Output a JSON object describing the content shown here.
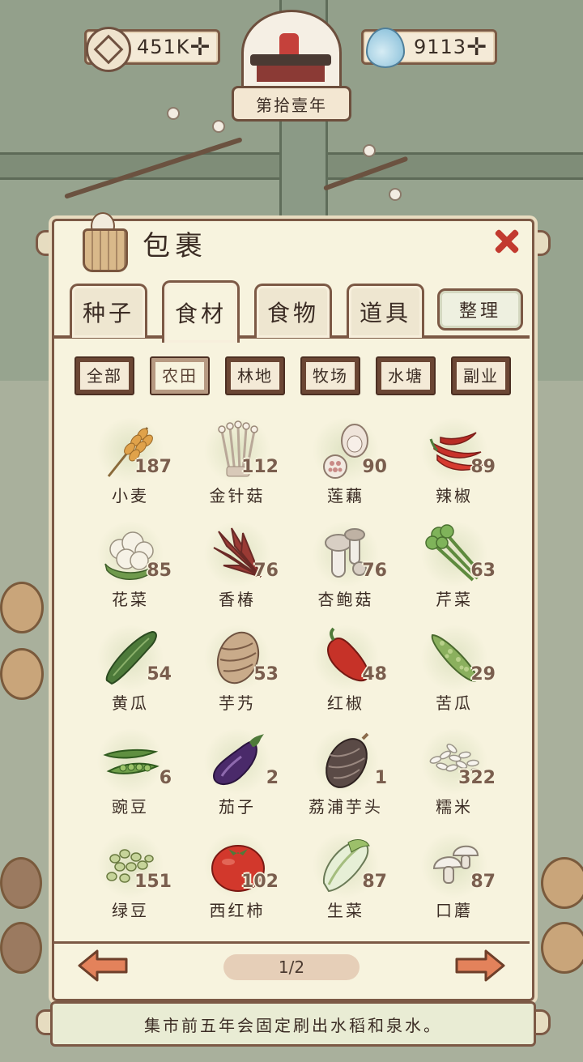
{
  "header": {
    "coins": "451K",
    "water": "9113",
    "year": "第拾壹年"
  },
  "panel": {
    "title": "包裹",
    "tabs": [
      {
        "label": "种子",
        "active": false
      },
      {
        "label": "食材",
        "active": true
      },
      {
        "label": "食物",
        "active": false
      },
      {
        "label": "道具",
        "active": false
      }
    ],
    "sort_label": "整理",
    "filters": [
      {
        "label": "全部",
        "active": false
      },
      {
        "label": "农田",
        "active": true
      },
      {
        "label": "林地",
        "active": false
      },
      {
        "label": "牧场",
        "active": false
      },
      {
        "label": "水塘",
        "active": false
      },
      {
        "label": "副业",
        "active": false
      }
    ],
    "items": [
      {
        "name": "小麦",
        "count": "187",
        "icon": "wheat-icon"
      },
      {
        "name": "金针菇",
        "count": "112",
        "icon": "enoki-icon"
      },
      {
        "name": "莲藕",
        "count": "90",
        "icon": "lotus-root-icon"
      },
      {
        "name": "辣椒",
        "count": "89",
        "icon": "chili-icon"
      },
      {
        "name": "花菜",
        "count": "85",
        "icon": "cauliflower-icon"
      },
      {
        "name": "香椿",
        "count": "76",
        "icon": "toon-sprout-icon"
      },
      {
        "name": "杏鲍菇",
        "count": "76",
        "icon": "king-oyster-icon"
      },
      {
        "name": "芹菜",
        "count": "63",
        "icon": "celery-icon"
      },
      {
        "name": "黄瓜",
        "count": "54",
        "icon": "cucumber-icon"
      },
      {
        "name": "芋艿",
        "count": "53",
        "icon": "taro-icon"
      },
      {
        "name": "红椒",
        "count": "48",
        "icon": "red-pepper-icon"
      },
      {
        "name": "苦瓜",
        "count": "29",
        "icon": "bitter-melon-icon"
      },
      {
        "name": "豌豆",
        "count": "6",
        "icon": "pea-icon"
      },
      {
        "name": "茄子",
        "count": "2",
        "icon": "eggplant-icon"
      },
      {
        "name": "荔浦芋头",
        "count": "1",
        "icon": "lipu-taro-icon"
      },
      {
        "name": "糯米",
        "count": "322",
        "icon": "glutinous-rice-icon"
      },
      {
        "name": "绿豆",
        "count": "151",
        "icon": "mung-bean-icon"
      },
      {
        "name": "西红柿",
        "count": "102",
        "icon": "tomato-icon"
      },
      {
        "name": "生菜",
        "count": "87",
        "icon": "lettuce-icon"
      },
      {
        "name": "口蘑",
        "count": "87",
        "icon": "button-mushroom-icon"
      }
    ],
    "page": "1/2"
  },
  "tip": "集市前五年会固定刷出水稻和泉水。",
  "colors": {
    "frame": "#7c5945",
    "paper": "#f7f3de",
    "close": "#c23a2f",
    "arrow": "#e07b52"
  }
}
